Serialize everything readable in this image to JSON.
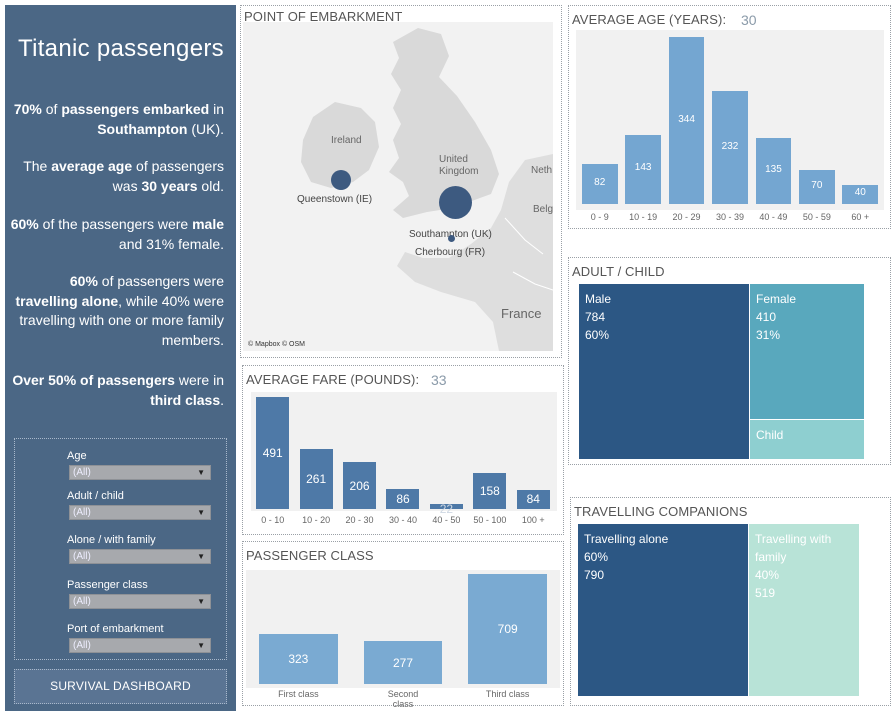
{
  "sidebar": {
    "title": "Titanic passengers",
    "facts": {
      "f1": {
        "a": "70%",
        "b": " of ",
        "c": "passengers embarked",
        "d": " in ",
        "e": "Southampton",
        "f": " (UK)."
      },
      "f2": {
        "a": "The ",
        "b": "average age",
        "c": " of passengers was ",
        "d": "30 years",
        "e": " old."
      },
      "f3": {
        "a": "60%",
        "b": " of the passengers were ",
        "c": "male",
        "d": " and 31% female."
      },
      "f4": {
        "a": "60%",
        "b": " of passengers were ",
        "c": "travelling alone",
        "d": ",  while 40% were travelling with one or more family members."
      },
      "f5": {
        "a": "Over 50% of passengers",
        "b": " were in ",
        "c": "third class",
        "d": "."
      }
    },
    "filters": [
      {
        "label": "Age",
        "value": "(All)"
      },
      {
        "label": "Adult / child",
        "value": "(All)"
      },
      {
        "label": "Alone / with family",
        "value": "(All)"
      },
      {
        "label": "Passenger class",
        "value": "(All)"
      },
      {
        "label": "Port of embarkment",
        "value": "(All)"
      }
    ],
    "button_label": "SURVIVAL DASHBOARD"
  },
  "map": {
    "title": "POINT OF EMBARKMENT",
    "labels": {
      "ireland": "Ireland",
      "uk": "United Kingdom",
      "netherlands": "Neth",
      "belgium": "Belg",
      "france": "France"
    },
    "ports": [
      {
        "name": "Queenstown (IE)"
      },
      {
        "name": "Southampton (UK)"
      },
      {
        "name": "Cherbourg (FR)"
      }
    ],
    "attribution": "© Mapbox  © OSM",
    "color": "#3d5a80"
  },
  "age_chart": {
    "title": "AVERAGE AGE (YEARS):",
    "value": "30"
  },
  "fare_chart": {
    "title": "AVERAGE FARE (POUNDS):",
    "value": "33"
  },
  "class_chart": {
    "title": "PASSENGER CLASS"
  },
  "adult_child": {
    "title": "ADULT / CHILD",
    "male": {
      "label": "Male",
      "count": "784",
      "pct": "60%"
    },
    "female": {
      "label": "Female",
      "count": "410",
      "pct": "31%"
    },
    "child": {
      "label": "Child"
    }
  },
  "companions": {
    "title": "TRAVELLING COMPANIONS",
    "alone": {
      "label": "Travelling alone",
      "pct": "60%",
      "count": "790"
    },
    "family": {
      "label": "Travelling with family",
      "pct": "40%",
      "count": "519"
    }
  },
  "colors": {
    "sidebar": "#4b6785",
    "age_bar": "#74a6d1",
    "fare_bar": "#4e79a7",
    "class_bar": "#7aaad2",
    "treemap_dark": "#2c5784",
    "treemap_teal": "#59a8bd",
    "treemap_light_teal": "#8ecfd0",
    "treemap_mint": "#b8e3d7"
  },
  "chart_data": [
    {
      "type": "bar",
      "title": "AVERAGE AGE (YEARS):",
      "categories": [
        "0 - 9",
        "10 - 19",
        "20 - 29",
        "30 - 39",
        "40 - 49",
        "50 - 59",
        "60 +"
      ],
      "values": [
        82,
        143,
        344,
        232,
        135,
        70,
        40
      ],
      "ylim": [
        0,
        344
      ]
    },
    {
      "type": "bar",
      "title": "AVERAGE FARE (POUNDS):",
      "categories": [
        "0 - 10",
        "10 - 20",
        "20 - 30",
        "30 - 40",
        "40 - 50",
        "50 - 100",
        "100 +"
      ],
      "values": [
        491,
        261,
        206,
        86,
        22,
        158,
        84
      ],
      "ylim": [
        0,
        491
      ]
    },
    {
      "type": "bar",
      "title": "PASSENGER CLASS",
      "categories": [
        "First class",
        "Second class",
        "Third class"
      ],
      "values": [
        323,
        277,
        709
      ],
      "ylim": [
        0,
        709
      ]
    }
  ]
}
